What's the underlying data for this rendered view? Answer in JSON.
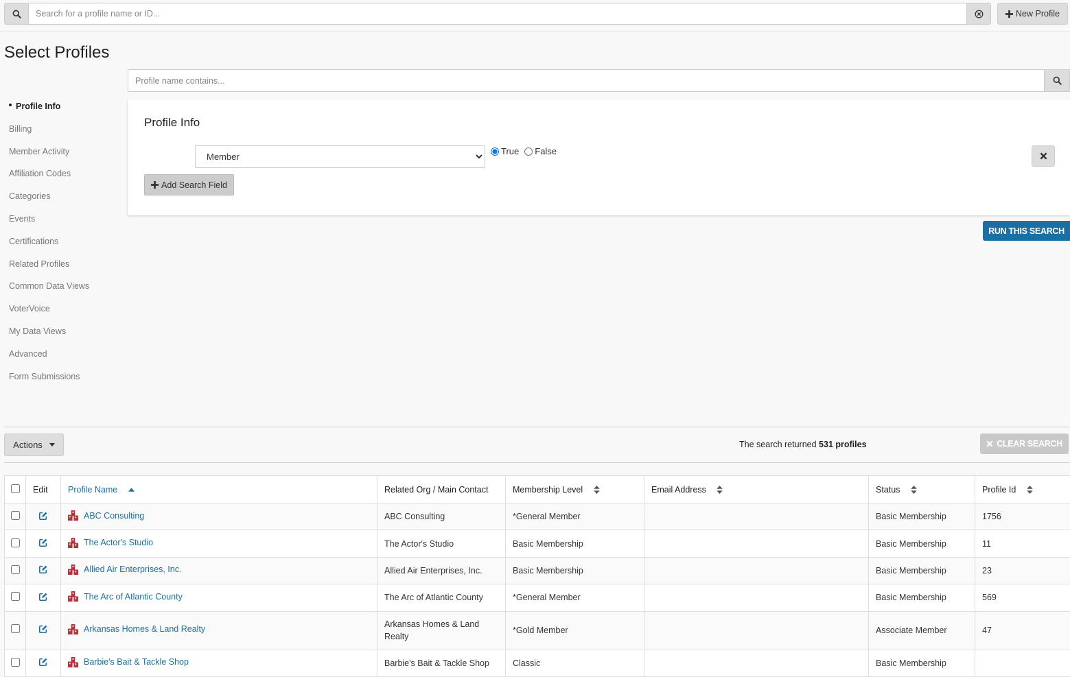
{
  "topbar": {
    "search_placeholder": "Search for a profile name or ID...",
    "new_profile_label": "New Profile"
  },
  "page": {
    "title": "Select Profiles"
  },
  "nav": {
    "items": [
      {
        "label": "Profile Info",
        "active": true
      },
      {
        "label": "Billing"
      },
      {
        "label": "Member Activity"
      },
      {
        "label": "Affiliation Codes"
      },
      {
        "label": "Categories"
      },
      {
        "label": "Events"
      },
      {
        "label": "Certifications"
      },
      {
        "label": "Related Profiles"
      },
      {
        "label": "Common Data Views"
      },
      {
        "label": "VoterVoice"
      },
      {
        "label": "My Data Views"
      },
      {
        "label": "Advanced"
      },
      {
        "label": "Form Submissions"
      }
    ]
  },
  "filter": {
    "name_placeholder": "Profile name contains..."
  },
  "card": {
    "title": "Profile Info",
    "field_value": "Member",
    "radio_true": "True",
    "radio_false": "False",
    "selected": "True",
    "add_field_label": "Add Search Field"
  },
  "run_search_label": "RUN THIS SEARCH",
  "results": {
    "actions_label": "Actions",
    "count_prefix": "The search returned",
    "count_value": "531 profiles",
    "clear_label": "CLEAR SEARCH"
  },
  "table": {
    "columns": {
      "edit": "Edit",
      "profile_name": "Profile Name",
      "related_org": "Related Org / Main Contact",
      "membership_level": "Membership Level",
      "email": "Email Address",
      "status": "Status",
      "profile_id": "Profile Id"
    },
    "rows": [
      {
        "name": "ABC Consulting",
        "org": "ABC Consulting",
        "level": "*General Member",
        "email": "",
        "status": "Basic Membership",
        "id": "1756"
      },
      {
        "name": "The Actor's Studio",
        "org": "The Actor's Studio",
        "level": "Basic Membership",
        "email": "",
        "status": "Basic Membership",
        "id": "11"
      },
      {
        "name": "Allied Air Enterprises, Inc.",
        "org": "Allied Air Enterprises, Inc.",
        "level": "Basic Membership",
        "email": "",
        "status": "Basic Membership",
        "id": "23"
      },
      {
        "name": "The Arc of Atlantic County",
        "org": "The Arc of Atlantic County",
        "level": "*General Member",
        "email": "",
        "status": "Basic Membership",
        "id": "569"
      },
      {
        "name": "Arkansas Homes & Land Realty",
        "org": "Arkansas Homes & Land Realty",
        "level": "*Gold Member",
        "email": "",
        "status": "Associate Member",
        "id": "47"
      },
      {
        "name": "Barbie's Bait & Tackle Shop",
        "org": "Barbie's Bait & Tackle Shop",
        "level": "Classic",
        "email": "",
        "status": "Basic Membership",
        "id": ""
      }
    ]
  },
  "colors": {
    "accent": "#1a6fa5",
    "org_icon": "#b8323a"
  }
}
